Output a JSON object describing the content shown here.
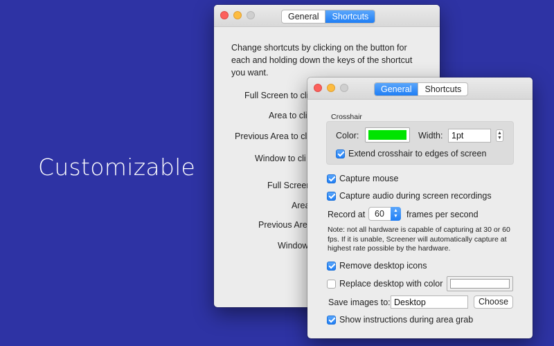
{
  "headline": "Customizable",
  "colors": {
    "background": "#2e33a4",
    "crosshair_color": "#00e400",
    "accent": "#1f7ef5"
  },
  "back_window": {
    "tabs": [
      {
        "label": "General",
        "active": false
      },
      {
        "label": "Shortcuts",
        "active": true
      }
    ],
    "description": "Change shortcuts by clicking on the button for each and holding down the keys of the shortcut you want.",
    "shortcut_labels": [
      "Full Screen to cli",
      "Area to cli",
      "Previous Area to cli",
      "Window to cli",
      "Full Screen",
      "Area",
      "Previous Area",
      "Window"
    ]
  },
  "front_window": {
    "tabs": [
      {
        "label": "General",
        "active": true
      },
      {
        "label": "Shortcuts",
        "active": false
      }
    ],
    "crosshair": {
      "group_title": "Crosshair",
      "color_label": "Color:",
      "width_label": "Width:",
      "width_value": "1pt",
      "extend_label": "Extend crosshair to edges of screen",
      "extend_checked": true
    },
    "capture_mouse": {
      "label": "Capture mouse",
      "checked": true
    },
    "capture_audio": {
      "label": "Capture audio during screen recordings",
      "checked": true
    },
    "record_at_label": "Record at",
    "fps_value": "60",
    "fps_suffix": "frames per second",
    "note": "Note: not all hardware is capable of capturing at 30 or 60 fps. If it is unable, Screener will automatically capture at highest rate possible by the hardware.",
    "remove_icons": {
      "label": "Remove desktop icons",
      "checked": true
    },
    "replace_desktop": {
      "label": "Replace desktop with color",
      "checked": false
    },
    "save_images_label": "Save images to:",
    "save_location": "Desktop",
    "choose_label": "Choose",
    "show_instructions": {
      "label": "Show instructions during area grab",
      "checked": true
    }
  }
}
